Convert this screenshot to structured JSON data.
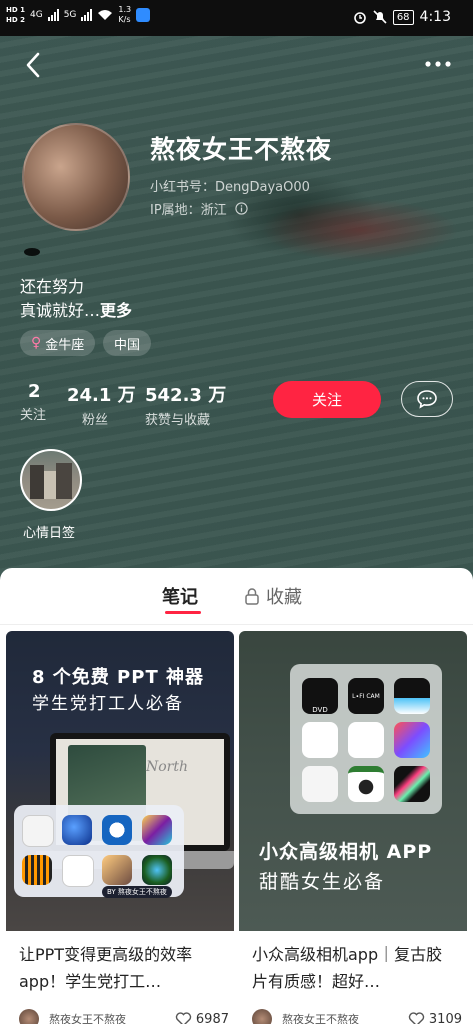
{
  "status_bar": {
    "sim1": "HD 1",
    "sim2": "HD 2",
    "net1": "4G",
    "net2": "5G",
    "speed_value": "1.3",
    "speed_unit": "K/s",
    "battery": "68",
    "time": "4:13"
  },
  "profile": {
    "name": "熬夜女王不熬夜",
    "id_text": "小红书号：DengDayaO00",
    "ip_text": "IP属地：浙江",
    "bio_line1": "还在努力",
    "bio_line2": "真诚就好…",
    "bio_more": "更多",
    "tags": [
      "金牛座",
      "中国"
    ],
    "stats": [
      {
        "value": "2",
        "label": "关注"
      },
      {
        "value": "24.1 万",
        "label": "粉丝"
      },
      {
        "value": "542.3 万",
        "label": "获赞与收藏"
      }
    ],
    "follow_label": "关注",
    "highlight_label": "心情日签"
  },
  "tabs": {
    "notes": "笔记",
    "favorites": "收藏"
  },
  "cards": [
    {
      "cover_line1": "8 个免费 PPT 神器",
      "cover_line2": "学生党打工人必备",
      "cover_word": "North",
      "cover_credit": "BY 熬夜女王不熬夜",
      "title": "让PPT变得更高级的效率app！学生党打工…",
      "author": "熬夜女王不熬夜",
      "likes": "6987"
    },
    {
      "cover_line1": "小众高级相机 APP",
      "cover_line2": "甜酷女生必备",
      "title": "小众高级相机app｜复古胶片有质感！超好…",
      "author": "熬夜女王不熬夜",
      "likes": "3109",
      "camera_labels": [
        "DVD",
        "L∙FI CAM"
      ]
    }
  ],
  "colors": {
    "accent": "#ff2442",
    "hero_bg": "#3d5751"
  }
}
